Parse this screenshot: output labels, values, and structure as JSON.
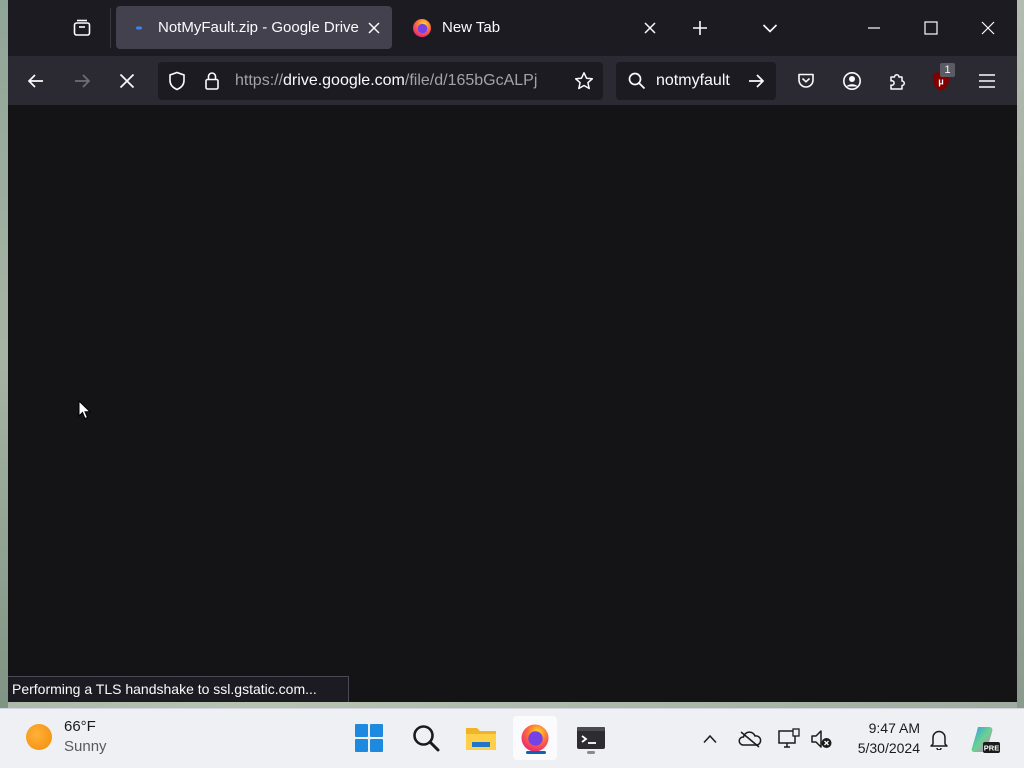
{
  "browser": {
    "tabs": [
      {
        "label": "NotMyFault.zip - Google Drive",
        "active": true,
        "favicon": "drive-loading-icon"
      },
      {
        "label": "New Tab",
        "active": false,
        "favicon": "firefox-icon"
      }
    ],
    "url_scheme": "https://",
    "url_host": "drive.google.com",
    "url_path": "/file/d/165bGcALPj",
    "search_query": "notmyfault",
    "extension_badge": "1",
    "status_text": "Performing a TLS handshake to ssl.gstatic.com..."
  },
  "taskbar": {
    "weather_temp": "66°F",
    "weather_condition": "Sunny",
    "time": "9:47 AM",
    "date": "5/30/2024",
    "apps": [
      "start-icon",
      "search-icon",
      "file-explorer-icon",
      "firefox-icon",
      "terminal-icon"
    ]
  },
  "colors": {
    "firefox_accent": "#00ddff",
    "taskbar_indicator": "#0a63b5"
  }
}
